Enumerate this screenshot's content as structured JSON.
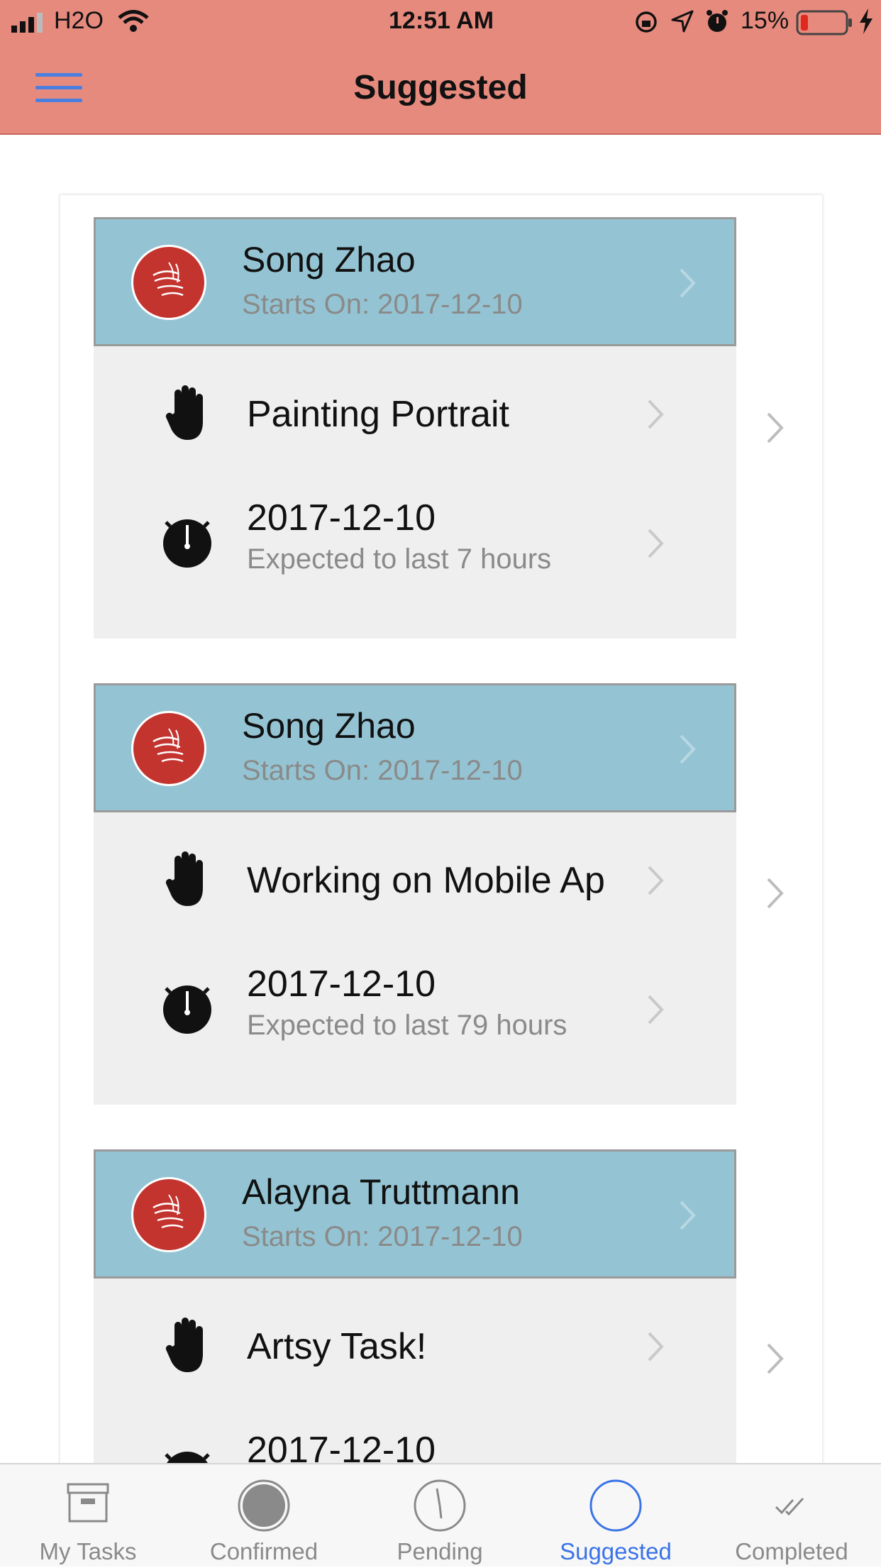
{
  "status_bar": {
    "carrier": "H2O",
    "time": "12:51 AM",
    "battery": "15%"
  },
  "header": {
    "title": "Suggested"
  },
  "tasks": [
    {
      "person": "Song Zhao",
      "starts": "Starts On: 2017-12-10",
      "title": "Painting Portrait",
      "date": "2017-12-10",
      "duration": "Expected to last 7 hours"
    },
    {
      "person": "Song Zhao",
      "starts": "Starts On: 2017-12-10",
      "title": "Working on Mobile Ap",
      "date": "2017-12-10",
      "duration": "Expected to last 79 hours"
    },
    {
      "person": "Alayna Truttmann",
      "starts": "Starts On: 2017-12-10",
      "title": "Artsy Task!",
      "date": "2017-12-10",
      "duration": ""
    }
  ],
  "tabs": [
    {
      "label": "My Tasks",
      "icon": "archive-box-icon",
      "active": false
    },
    {
      "label": "Confirmed",
      "icon": "filled-circle-icon",
      "active": false
    },
    {
      "label": "Pending",
      "icon": "clock-icon",
      "active": false
    },
    {
      "label": "Suggested",
      "icon": "empty-circle-icon",
      "active": true
    },
    {
      "label": "Completed",
      "icon": "double-check-icon",
      "active": false
    }
  ],
  "colors": {
    "header_bg": "#e78a7e",
    "person_row_bg": "#94c4d3",
    "details_bg": "#efefef",
    "avatar_bg": "#c3342f",
    "active_tab": "#3a73e6"
  }
}
